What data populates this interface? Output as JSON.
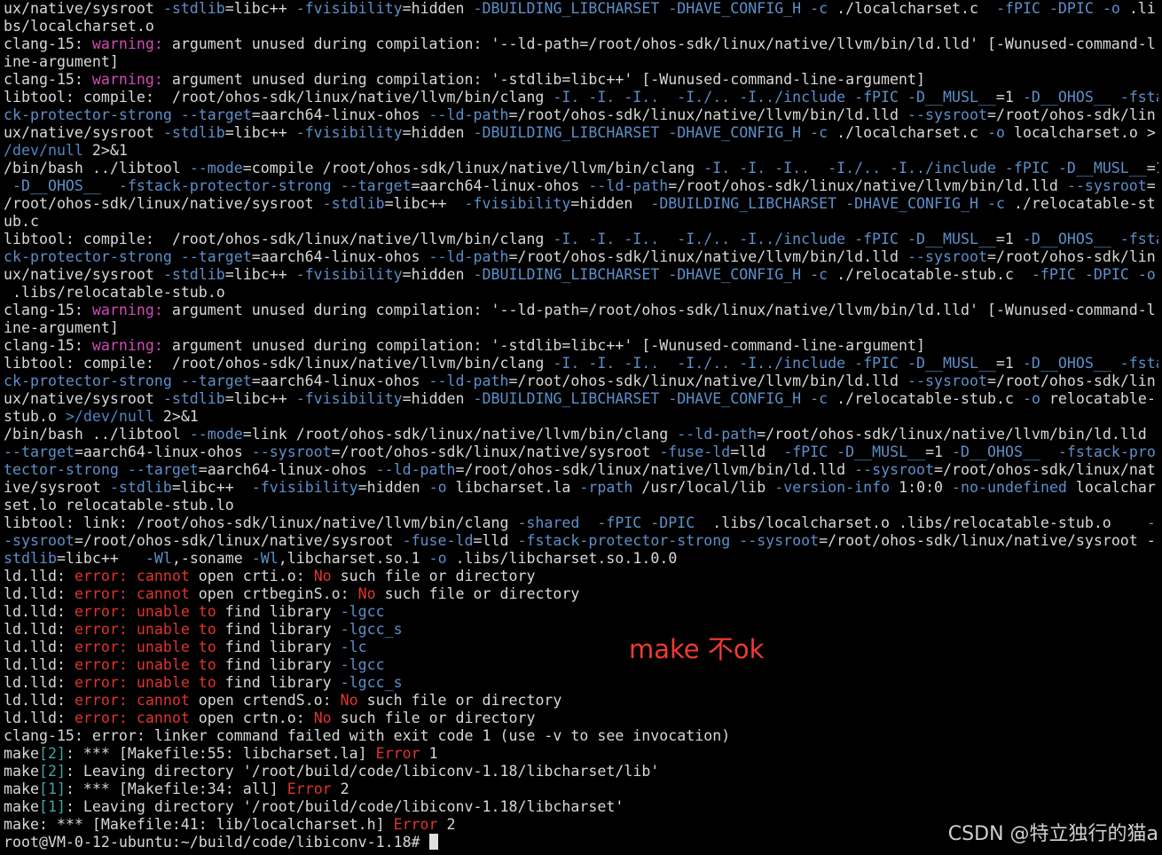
{
  "colors": {
    "default": "#d8d8d8",
    "flag": "#5d8fc9",
    "warning": "#d34ab6",
    "error": "#e0342e",
    "path": "#4f86c6",
    "bracket": "#3fa6a6",
    "annotation": "#ef3b33",
    "watermark": "#d0d0d0",
    "background": "#000000"
  },
  "annotation": "make 不ok",
  "watermark": "CSDN @特立独行的猫a",
  "cursor_icon": "block-cursor",
  "terminal_lines": [
    [
      [
        "ux/native/sysroot ",
        "t"
      ],
      [
        "-stdlib",
        "f"
      ],
      [
        "=libc++ ",
        "t"
      ],
      [
        "-fvisibility",
        "f"
      ],
      [
        "=hidden ",
        "t"
      ],
      [
        "-DBUILDING_LIBCHARSET -DHAVE_CONFIG_H -c",
        "f"
      ],
      [
        " ./localcharset.c  ",
        "t"
      ],
      [
        "-fPIC -DPIC -o",
        "f"
      ],
      [
        " .li",
        "t"
      ]
    ],
    [
      [
        "bs/localcharset.o",
        "t"
      ]
    ],
    [
      [
        "clang-15: ",
        "t"
      ],
      [
        "warning:",
        "w"
      ],
      [
        " argument unused during compilation: '--ld-path=/root/ohos-sdk/linux/native/llvm/bin/ld.lld' [-Wunused-command-l",
        "t"
      ]
    ],
    [
      [
        "ine-argument]",
        "t"
      ]
    ],
    [
      [
        "clang-15: ",
        "t"
      ],
      [
        "warning:",
        "w"
      ],
      [
        " argument unused during compilation: '-stdlib=libc++' [-Wunused-command-line-argument]",
        "t"
      ]
    ],
    [
      [
        "libtool: compile:  /root/ohos-sdk/linux/native/llvm/bin/clang ",
        "t"
      ],
      [
        "-I. -I. -I..  -I./.. -I../include -fPIC -D__MUSL__",
        "f"
      ],
      [
        "=1 ",
        "t"
      ],
      [
        "-D__OHOS__ -fsta",
        "f"
      ]
    ],
    [
      [
        "ck-protector-strong --target",
        "f"
      ],
      [
        "=aarch64-linux-ohos ",
        "t"
      ],
      [
        "--ld-path",
        "f"
      ],
      [
        "=/root/ohos-sdk/linux/native/llvm/bin/ld.lld ",
        "t"
      ],
      [
        "--sysroot",
        "f"
      ],
      [
        "=/root/ohos-sdk/lin",
        "t"
      ]
    ],
    [
      [
        "ux/native/sysroot ",
        "t"
      ],
      [
        "-stdlib",
        "f"
      ],
      [
        "=libc++ ",
        "t"
      ],
      [
        "-fvisibility",
        "f"
      ],
      [
        "=hidden ",
        "t"
      ],
      [
        "-DBUILDING_LIBCHARSET -DHAVE_CONFIG_H -c",
        "f"
      ],
      [
        " ./localcharset.c ",
        "t"
      ],
      [
        "-o",
        "f"
      ],
      [
        " localcharset.o >",
        "t"
      ]
    ],
    [
      [
        "/dev/null",
        "p"
      ],
      [
        " 2>&1",
        "t"
      ]
    ],
    [
      [
        "/bin/bash ../libtool ",
        "t"
      ],
      [
        "--mode",
        "f"
      ],
      [
        "=compile /root/ohos-sdk/linux/native/llvm/bin/clang ",
        "t"
      ],
      [
        "-I. -I. -I..  -I./.. -I../include -fPIC -D__MUSL__",
        "f"
      ],
      [
        "=1",
        "t"
      ]
    ],
    [
      [
        " -D__OHOS__  -fstack-protector-strong --target",
        "f"
      ],
      [
        "=aarch64-linux-ohos ",
        "t"
      ],
      [
        "--ld-path",
        "f"
      ],
      [
        "=/root/ohos-sdk/linux/native/llvm/bin/ld.lld ",
        "t"
      ],
      [
        "--sysroot",
        "f"
      ],
      [
        "=",
        "t"
      ]
    ],
    [
      [
        "/root/ohos-sdk/linux/native/sysroot ",
        "t"
      ],
      [
        "-stdlib",
        "f"
      ],
      [
        "=libc++  ",
        "t"
      ],
      [
        "-fvisibility",
        "f"
      ],
      [
        "=hidden  ",
        "t"
      ],
      [
        "-DBUILDING_LIBCHARSET -DHAVE_CONFIG_H -c",
        "f"
      ],
      [
        " ./relocatable-st",
        "t"
      ]
    ],
    [
      [
        "ub.c",
        "t"
      ]
    ],
    [
      [
        "libtool: compile:  /root/ohos-sdk/linux/native/llvm/bin/clang ",
        "t"
      ],
      [
        "-I. -I. -I..  -I./.. -I../include -fPIC -D__MUSL__",
        "f"
      ],
      [
        "=1 ",
        "t"
      ],
      [
        "-D__OHOS__ -fsta",
        "f"
      ]
    ],
    [
      [
        "ck-protector-strong --target",
        "f"
      ],
      [
        "=aarch64-linux-ohos ",
        "t"
      ],
      [
        "--ld-path",
        "f"
      ],
      [
        "=/root/ohos-sdk/linux/native/llvm/bin/ld.lld ",
        "t"
      ],
      [
        "--sysroot",
        "f"
      ],
      [
        "=/root/ohos-sdk/lin",
        "t"
      ]
    ],
    [
      [
        "ux/native/sysroot ",
        "t"
      ],
      [
        "-stdlib",
        "f"
      ],
      [
        "=libc++ ",
        "t"
      ],
      [
        "-fvisibility",
        "f"
      ],
      [
        "=hidden ",
        "t"
      ],
      [
        "-DBUILDING_LIBCHARSET -DHAVE_CONFIG_H -c",
        "f"
      ],
      [
        " ./relocatable-stub.c  ",
        "t"
      ],
      [
        "-fPIC -DPIC -o",
        "f"
      ]
    ],
    [
      [
        " .libs/relocatable-stub.o",
        "t"
      ]
    ],
    [
      [
        "clang-15: ",
        "t"
      ],
      [
        "warning:",
        "w"
      ],
      [
        " argument unused during compilation: '--ld-path=/root/ohos-sdk/linux/native/llvm/bin/ld.lld' [-Wunused-command-l",
        "t"
      ]
    ],
    [
      [
        "ine-argument]",
        "t"
      ]
    ],
    [
      [
        "clang-15: ",
        "t"
      ],
      [
        "warning:",
        "w"
      ],
      [
        " argument unused during compilation: '-stdlib=libc++' [-Wunused-command-line-argument]",
        "t"
      ]
    ],
    [
      [
        "libtool: compile:  /root/ohos-sdk/linux/native/llvm/bin/clang ",
        "t"
      ],
      [
        "-I. -I. -I..  -I./.. -I../include -fPIC -D__MUSL__",
        "f"
      ],
      [
        "=1 ",
        "t"
      ],
      [
        "-D__OHOS__ -fsta",
        "f"
      ]
    ],
    [
      [
        "ck-protector-strong --target",
        "f"
      ],
      [
        "=aarch64-linux-ohos ",
        "t"
      ],
      [
        "--ld-path",
        "f"
      ],
      [
        "=/root/ohos-sdk/linux/native/llvm/bin/ld.lld ",
        "t"
      ],
      [
        "--sysroot",
        "f"
      ],
      [
        "=/root/ohos-sdk/lin",
        "t"
      ]
    ],
    [
      [
        "ux/native/sysroot ",
        "t"
      ],
      [
        "-stdlib",
        "f"
      ],
      [
        "=libc++ ",
        "t"
      ],
      [
        "-fvisibility",
        "f"
      ],
      [
        "=hidden ",
        "t"
      ],
      [
        "-DBUILDING_LIBCHARSET -DHAVE_CONFIG_H -c",
        "f"
      ],
      [
        " ./relocatable-stub.c ",
        "t"
      ],
      [
        "-o",
        "f"
      ],
      [
        " relocatable-",
        "t"
      ]
    ],
    [
      [
        "stub.o ",
        "t"
      ],
      [
        ">/dev/null",
        "p"
      ],
      [
        " 2>&1",
        "t"
      ]
    ],
    [
      [
        "/bin/bash ../libtool ",
        "t"
      ],
      [
        "--mode",
        "f"
      ],
      [
        "=link /root/ohos-sdk/linux/native/llvm/bin/clang ",
        "t"
      ],
      [
        "--ld-path",
        "f"
      ],
      [
        "=/root/ohos-sdk/linux/native/llvm/bin/ld.lld",
        "t"
      ]
    ],
    [
      [
        "--target",
        "f"
      ],
      [
        "=aarch64-linux-ohos ",
        "t"
      ],
      [
        "--sysroot",
        "f"
      ],
      [
        "=/root/ohos-sdk/linux/native/sysroot ",
        "t"
      ],
      [
        "-fuse-ld",
        "f"
      ],
      [
        "=lld  ",
        "t"
      ],
      [
        "-fPIC -D__MUSL__",
        "f"
      ],
      [
        "=1 ",
        "t"
      ],
      [
        "-D__OHOS__  -fstack-pro",
        "f"
      ]
    ],
    [
      [
        "tector-strong --target",
        "f"
      ],
      [
        "=aarch64-linux-ohos ",
        "t"
      ],
      [
        "--ld-path",
        "f"
      ],
      [
        "=/root/ohos-sdk/linux/native/llvm/bin/ld.lld ",
        "t"
      ],
      [
        "--sysroot",
        "f"
      ],
      [
        "=/root/ohos-sdk/linux/nat",
        "t"
      ]
    ],
    [
      [
        "ive/sysroot ",
        "t"
      ],
      [
        "-stdlib",
        "f"
      ],
      [
        "=libc++  ",
        "t"
      ],
      [
        "-fvisibility",
        "f"
      ],
      [
        "=hidden ",
        "t"
      ],
      [
        "-o",
        "f"
      ],
      [
        " libcharset.la ",
        "t"
      ],
      [
        "-rpath",
        "f"
      ],
      [
        " /usr/local/lib ",
        "t"
      ],
      [
        "-version-info",
        "f"
      ],
      [
        " 1:0:0 ",
        "t"
      ],
      [
        "-no-undefined",
        "f"
      ],
      [
        " localchar",
        "t"
      ]
    ],
    [
      [
        "set.lo relocatable-stub.lo",
        "t"
      ]
    ],
    [
      [
        "libtool: link: /root/ohos-sdk/linux/native/llvm/bin/clang ",
        "t"
      ],
      [
        "-shared  -fPIC -DPIC",
        "f"
      ],
      [
        "  .libs/localcharset.o .libs/relocatable-stub.o    ",
        "t"
      ],
      [
        "-",
        "f"
      ]
    ],
    [
      [
        "-sysroot",
        "f"
      ],
      [
        "=/root/ohos-sdk/linux/native/sysroot ",
        "t"
      ],
      [
        "-fuse-ld",
        "f"
      ],
      [
        "=lld ",
        "t"
      ],
      [
        "-fstack-protector-strong --sysroot",
        "f"
      ],
      [
        "=/root/ohos-sdk/linux/native/sysroot -",
        "t"
      ]
    ],
    [
      [
        "stdlib",
        "f"
      ],
      [
        "=libc++   ",
        "t"
      ],
      [
        "-Wl",
        "f"
      ],
      [
        ",-soname ",
        "t"
      ],
      [
        "-Wl",
        "f"
      ],
      [
        ",libcharset.so.1 ",
        "t"
      ],
      [
        "-o",
        "f"
      ],
      [
        " .libs/libcharset.so.1.0.0",
        "t"
      ]
    ],
    [
      [
        "ld.lld: ",
        "t"
      ],
      [
        "error: cannot",
        "e"
      ],
      [
        " open crti.o: ",
        "t"
      ],
      [
        "No",
        "e"
      ],
      [
        " such file or directory",
        "t"
      ]
    ],
    [
      [
        "ld.lld: ",
        "t"
      ],
      [
        "error: cannot",
        "e"
      ],
      [
        " open crtbeginS.o: ",
        "t"
      ],
      [
        "No",
        "e"
      ],
      [
        " such file or directory",
        "t"
      ]
    ],
    [
      [
        "ld.lld: ",
        "t"
      ],
      [
        "error: unable to",
        "e"
      ],
      [
        " find library ",
        "t"
      ],
      [
        "-lgcc",
        "f"
      ]
    ],
    [
      [
        "ld.lld: ",
        "t"
      ],
      [
        "error: unable to",
        "e"
      ],
      [
        " find library ",
        "t"
      ],
      [
        "-lgcc_s",
        "f"
      ]
    ],
    [
      [
        "ld.lld: ",
        "t"
      ],
      [
        "error: unable to",
        "e"
      ],
      [
        " find library ",
        "t"
      ],
      [
        "-lc",
        "f"
      ]
    ],
    [
      [
        "ld.lld: ",
        "t"
      ],
      [
        "error: unable to",
        "e"
      ],
      [
        " find library ",
        "t"
      ],
      [
        "-lgcc",
        "f"
      ]
    ],
    [
      [
        "ld.lld: ",
        "t"
      ],
      [
        "error: unable to",
        "e"
      ],
      [
        " find library ",
        "t"
      ],
      [
        "-lgcc_s",
        "f"
      ]
    ],
    [
      [
        "ld.lld: ",
        "t"
      ],
      [
        "error: cannot",
        "e"
      ],
      [
        " open crtendS.o: ",
        "t"
      ],
      [
        "No",
        "e"
      ],
      [
        " such file or directory",
        "t"
      ]
    ],
    [
      [
        "ld.lld: ",
        "t"
      ],
      [
        "error: cannot",
        "e"
      ],
      [
        " open crtn.o: ",
        "t"
      ],
      [
        "No",
        "e"
      ],
      [
        " such file or directory",
        "t"
      ]
    ],
    [
      [
        "clang-15: error: linker command failed with exit code 1 (use -v to see invocation)",
        "t"
      ]
    ],
    [
      [
        "make",
        "t"
      ],
      [
        "[2]",
        "b"
      ],
      [
        ": *** [Makefile:55: libcharset.la] ",
        "t"
      ],
      [
        "Error",
        "e"
      ],
      [
        " 1",
        "t"
      ]
    ],
    [
      [
        "make",
        "t"
      ],
      [
        "[2]",
        "b"
      ],
      [
        ": Leaving directory '/root/build/code/libiconv-1.18/libcharset/lib'",
        "t"
      ]
    ],
    [
      [
        "make",
        "t"
      ],
      [
        "[1]",
        "b"
      ],
      [
        ": *** [Makefile:34: all] ",
        "t"
      ],
      [
        "Error",
        "e"
      ],
      [
        " 2",
        "t"
      ]
    ],
    [
      [
        "make",
        "t"
      ],
      [
        "[1]",
        "b"
      ],
      [
        ": Leaving directory '/root/build/code/libiconv-1.18/libcharset'",
        "t"
      ]
    ],
    [
      [
        "make: *** [Makefile:41: lib/localcharset.h] ",
        "t"
      ],
      [
        "Error",
        "e"
      ],
      [
        " 2",
        "t"
      ]
    ],
    [
      [
        "root@VM-0-12-ubuntu:~/build/code/libiconv-1.18# ",
        "t"
      ]
    ]
  ]
}
